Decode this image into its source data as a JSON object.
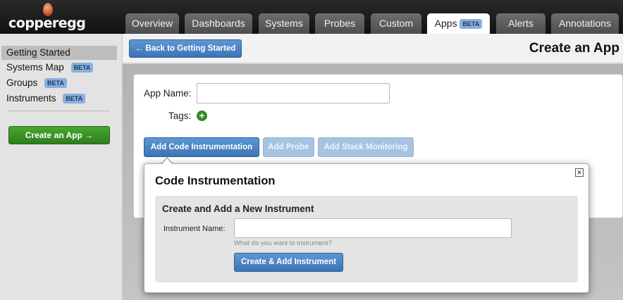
{
  "brand": {
    "name": "copperegg"
  },
  "nav": {
    "tabs": [
      {
        "label": "Overview"
      },
      {
        "label": "Dashboards"
      },
      {
        "label": "Systems"
      },
      {
        "label": "Probes"
      },
      {
        "label": "Custom"
      },
      {
        "label": "Apps",
        "badge": "BETA",
        "active": true
      },
      {
        "label": "Alerts"
      },
      {
        "label": "Annotations"
      }
    ]
  },
  "sidebar": {
    "items": [
      {
        "label": "Getting Started",
        "selected": true
      },
      {
        "label": "Systems Map",
        "badge": "BETA"
      },
      {
        "label": "Groups",
        "badge": "BETA"
      },
      {
        "label": "Instruments",
        "badge": "BETA"
      }
    ],
    "create_button": "Create an App →"
  },
  "header": {
    "back_button": "← Back to Getting Started",
    "title": "Create an App"
  },
  "form": {
    "app_name_label": "App Name:",
    "app_name_value": "",
    "tags_label": "Tags:",
    "tag_add_icon": "plus-circle-icon",
    "actions": [
      {
        "label": "Add Code Instrumentation",
        "state": "active"
      },
      {
        "label": "Add Probe",
        "state": "disabled"
      },
      {
        "label": "Add Stack Monitoring",
        "state": "disabled"
      }
    ]
  },
  "popover": {
    "title": "Code Instrumentation",
    "close_icon": "close-icon",
    "section_title": "Create and Add a New Instrument",
    "instrument_name_label": "Instrument Name:",
    "instrument_name_value": "",
    "instrument_name_hint": "What do you want to instrument?",
    "submit_button": "Create & Add Instrument"
  },
  "colors": {
    "primary_button": "#3d74b4",
    "create_button": "#2d7d1c",
    "beta_badge": "#8ab0dc",
    "topbar": "#1a1a1a"
  }
}
